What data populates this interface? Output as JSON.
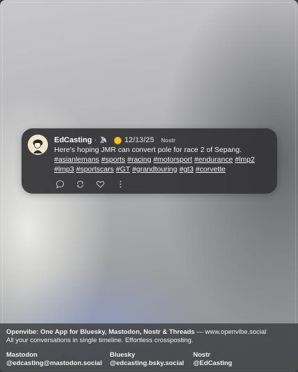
{
  "post": {
    "author": "EdCasting",
    "separator": "·",
    "date": "12/13/25",
    "network": "Nostr",
    "text": "Here's hoping JMR can convert pole for race 2 of Sepang.",
    "hashtags": [
      "#asianlemans",
      "#sports",
      "#racing",
      "#motorsport",
      "#endurance",
      "#lmp2",
      "#lmp3",
      "#sportscars",
      "#GT",
      "#grandtouring",
      "#gt3",
      "#corvette"
    ]
  },
  "footer": {
    "title": "Openvibe: One App for Bluesky, Mastodon, Nostr & Threads",
    "dash": " — ",
    "url": "www.openvibe.social",
    "subtitle": "All your conversations in single timeline. Effortless crossposting.",
    "accounts": [
      {
        "network": "Mastodon",
        "handle": "@edcasting@mastodon.social"
      },
      {
        "network": "Bluesky",
        "handle": "@edcasting.bsky.social"
      },
      {
        "network": "Nostr",
        "handle": "@EdCasting"
      }
    ]
  },
  "colors": {
    "card": "#343436",
    "coin": "#f2c230",
    "footer": "#3c3d40"
  },
  "icons": [
    "satellite-dish-icon",
    "coin-icon",
    "reply-icon",
    "repost-icon",
    "like-icon",
    "more-icon"
  ]
}
